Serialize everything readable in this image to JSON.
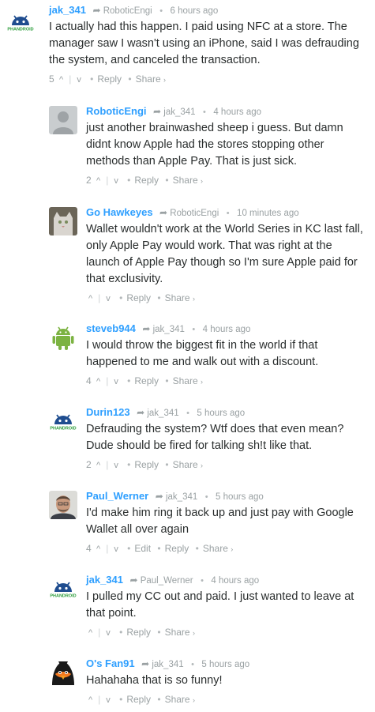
{
  "comments": [
    {
      "author": "jak_341",
      "parent": "RoboticEngi",
      "time": "6 hours ago",
      "text": "I actually had this happen. I paid using NFC at a store. The manager saw I wasn't using an iPhone, said I was defrauding the system, and canceled the transaction.",
      "votes": "5",
      "avatar": "android-avatar",
      "avatar_label": "PHANDROID"
    },
    {
      "author": "RoboticEngi",
      "parent": "jak_341",
      "time": "4 hours ago",
      "text": "just another brainwashed sheep i guess. But damn didnt know Apple had the stores stopping other methods than Apple Pay. That is just sick.",
      "votes": "2",
      "avatar": "default-avatar"
    },
    {
      "author": "Go Hawkeyes",
      "parent": "RoboticEngi",
      "time": "10 minutes ago",
      "text": "Wallet wouldn't work at the World Series in KC last fall, only Apple Pay would work. That was right at the launch of Apple Pay though so I'm sure Apple paid for that exclusivity.",
      "votes": "",
      "avatar": "cat-avatar"
    },
    {
      "author": "steveb944",
      "parent": "jak_341",
      "time": "4 hours ago",
      "text": "I would throw the biggest fit in the world if that happened to me and walk out with a discount.",
      "votes": "4",
      "avatar": "android-green-avatar"
    },
    {
      "author": "Durin123",
      "parent": "jak_341",
      "time": "5 hours ago",
      "text": "Defrauding the system? Wtf does that even mean? Dude should be fired for talking sh!t like that.",
      "votes": "2",
      "avatar": "android-avatar",
      "avatar_label": "PHANDROID"
    },
    {
      "author": "Paul_Werner",
      "parent": "jak_341",
      "time": "5 hours ago",
      "text": "I'd make him ring it back up and just pay with Google Wallet all over again",
      "votes": "4",
      "avatar": "person-avatar",
      "has_edit": true
    },
    {
      "author": "jak_341",
      "parent": "Paul_Werner",
      "time": "4 hours ago",
      "text": "I pulled my CC out and paid. I just wanted to leave at that point.",
      "votes": "",
      "avatar": "android-avatar",
      "avatar_label": "PHANDROID"
    },
    {
      "author": "O's Fan91",
      "parent": "jak_341",
      "time": "5 hours ago",
      "text": "Hahahaha that is so funny!",
      "votes": "",
      "avatar": "oriole-avatar"
    }
  ],
  "labels": {
    "reply": "Reply",
    "share": "Share",
    "edit": "Edit",
    "share_caret": "›",
    "vote_up": "^",
    "vote_down": "v",
    "reply_arrow": "➦",
    "separator": "•"
  },
  "colors": {
    "link": "#2e9fff",
    "text": "#2a2e2e",
    "muted": "#9aa1a3",
    "android_blue": "#1f4d8f",
    "android_green": "#7cb342"
  }
}
